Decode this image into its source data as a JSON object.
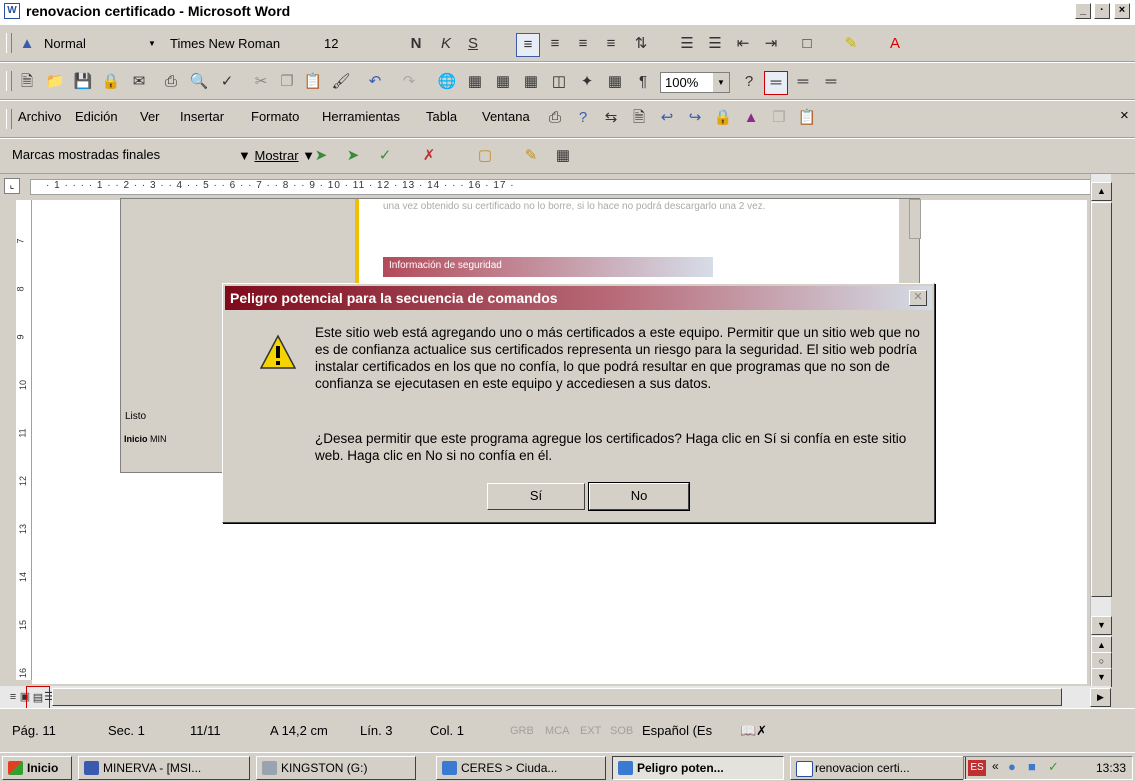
{
  "window": {
    "title": "renovacion certificado - Microsoft Word",
    "icon_letter": "W"
  },
  "caption_buttons": {
    "minimize": "_",
    "restore": "·",
    "close": "×"
  },
  "format_toolbar": {
    "style": "Normal",
    "font": "Times New Roman",
    "size": "12"
  },
  "standard_toolbar": {
    "zoom": "100%"
  },
  "menu": {
    "items": [
      "Archivo",
      "Edición",
      "Ver",
      "Insertar",
      "Formato",
      "Herramientas",
      "Tabla",
      "Ventana"
    ],
    "close_doc": "×"
  },
  "review_toolbar": {
    "markup": "Marcas mostradas finales",
    "show": "Mostrar"
  },
  "ruler": {
    "numbers": "· 1 · · · · 1 · · 2 · · 3 · · 4 · · 5 · · 6 · · 7 · · 8 · · 9 · 10 · 11 · 12 · 13 · 14 · · · 16 · 17 ·"
  },
  "vruler": {
    "numbers": [
      "7",
      "8",
      "9",
      "10",
      "11",
      "12",
      "13",
      "14",
      "15",
      "16"
    ]
  },
  "doc_screenshot": {
    "faint_text": "una vez obtenido su certificado no lo borre, si lo hace no podrá descargarlo una 2 vez.",
    "security_title": "Información de seguridad",
    "listo": "Listo",
    "mini_start": "Inicio",
    "mini_task": "MIN"
  },
  "dialog": {
    "title": "Peligro potencial para la secuencia de comandos",
    "message": "Este sitio web está agregando uno o más certificados a este equipo. Permitir que un sitio web que no es de confianza actualice sus certificados representa un riesgo para la seguridad. El sitio web podría instalar certificados en los que no confía, lo que podrá resultar en que programas que no son de confianza se ejecutasen en este equipo y accediesen a sus datos.",
    "question": "¿Desea permitir que este programa agregue los certificados? Haga clic en Sí si confía en este sitio web. Haga clic en No si no confía en él.",
    "yes": "Sí",
    "no": "No"
  },
  "status": {
    "page": "Pág. 11",
    "section": "Sec. 1",
    "pages": "11/11",
    "position": "A 14,2 cm",
    "line": "Lín. 3",
    "col": "Col. 1",
    "grb": "GRB",
    "mca": "MCA",
    "ext": "EXT",
    "sob": "SOB",
    "lang": "Español (Es"
  },
  "taskbar": {
    "start": "Inicio",
    "tasks": [
      "MINERVA - [MSI...",
      "KINGSTON (G:)",
      "CERES > Ciuda...",
      "Peligro poten...",
      "renovacion certi..."
    ],
    "lang": "ES",
    "clock": "13:33"
  },
  "colors": {
    "dialog_caption_start": "#7e0a1a",
    "warning_yellow": "#f5d400",
    "taskbar_bg": "#d4d0c8"
  }
}
